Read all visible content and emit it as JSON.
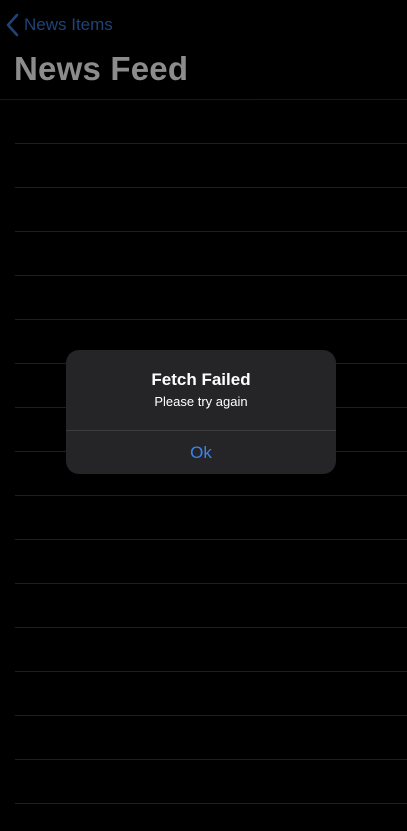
{
  "nav": {
    "back_label": "News Items",
    "title": "News Feed"
  },
  "list": {
    "row_count": 17
  },
  "alert": {
    "title": "Fetch Failed",
    "message": "Please try again",
    "button_label": "Ok"
  },
  "colors": {
    "background": "#000000",
    "accent": "#3a84f0",
    "alert_background": "#252527",
    "separator": "#3a3a3c"
  }
}
